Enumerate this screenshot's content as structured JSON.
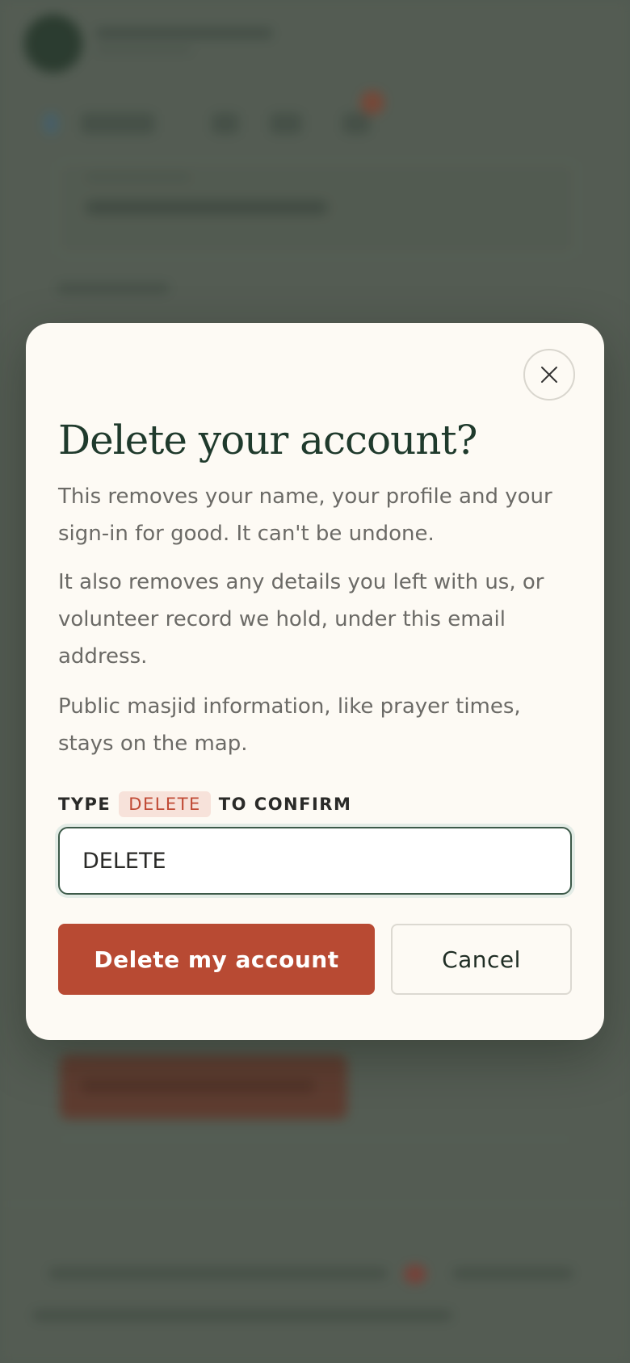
{
  "modal": {
    "title": "Delete your account?",
    "paragraphs": [
      "This removes your name, your profile and your sign-in for good. It can't be undone.",
      "It also removes any details you left with us, or volunteer record we hold, under this email address.",
      "Public masjid information, like prayer times, stays on the map."
    ],
    "confirm_prefix": "TYPE",
    "confirm_keyword": "DELETE",
    "confirm_suffix": "TO CONFIRM",
    "input_value": "DELETE",
    "delete_button": "Delete my account",
    "cancel_button": "Cancel",
    "close_icon": "close-icon"
  },
  "colors": {
    "accent_green": "#1f3a2c",
    "danger": "#b84a33",
    "modal_bg": "#fdfaf4",
    "keyword_bg": "#f7e2da",
    "keyword_text": "#c04a35"
  }
}
